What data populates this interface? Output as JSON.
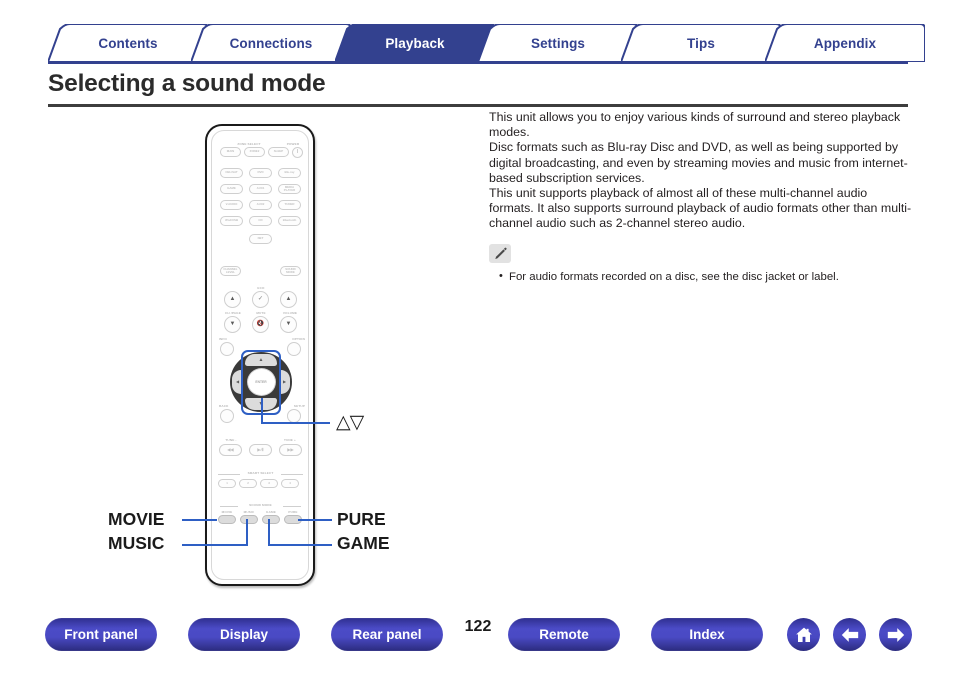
{
  "tabs": [
    {
      "label": "Contents",
      "active": false
    },
    {
      "label": "Connections",
      "active": false
    },
    {
      "label": "Playback",
      "active": true
    },
    {
      "label": "Settings",
      "active": false
    },
    {
      "label": "Tips",
      "active": false
    },
    {
      "label": "Appendix",
      "active": false
    }
  ],
  "page": {
    "title": "Selecting a sound mode",
    "number": "122"
  },
  "body": {
    "paragraphs": [
      "This unit allows you to enjoy various kinds of surround and stereo playback modes.",
      "Disc formats such as Blu-ray Disc and DVD, as well as being supported by digital broadcasting, and even by streaming movies and music from internet-based subscription services.",
      "This unit supports playback of almost all of these multi-channel audio formats. It also supports surround playback of audio formats other than multi-channel audio such as 2-channel stereo audio."
    ]
  },
  "note": {
    "icon": "pencil-note-icon",
    "items": [
      "For audio formats recorded on a disc, see the disc jacket or label."
    ]
  },
  "callouts": {
    "cursor_updown": "△▽",
    "movie": "MOVIE",
    "music": "MUSIC",
    "pure": "PURE",
    "game": "GAME"
  },
  "remote": {
    "sections": {
      "zone_select": "ZONE SELECT",
      "power": "POWER",
      "sound_mode": "SOUND MODE",
      "smart_select": "SMART SELECT"
    },
    "labels": {
      "ch_page": "CH /PAGE",
      "volume": "VOLUME",
      "eco": "ECO",
      "mute": "MUTE",
      "info": "INFO",
      "option": "OPTION",
      "back": "BACK",
      "setup": "SETUP",
      "tune_minus": "TUNE -",
      "tune_plus": "TUNE +",
      "enter": "ENTER"
    },
    "source_buttons": [
      "MAIN",
      "ZONE2",
      "SLEEP",
      "CBL/SAT",
      "DVD",
      "Blu-ray",
      "GAME",
      "AUX1",
      "MEDIA PLAYER",
      "V.AUDIO",
      "AUX2",
      "TUNER",
      "iPod/USB",
      "CD",
      "Bluetooth",
      "NET"
    ],
    "sound_mode_buttons": [
      "MOVIE",
      "MUSIC",
      "GAME",
      "PURE"
    ],
    "smart_select_buttons": [
      "1",
      "2",
      "3",
      "4"
    ],
    "transport": [
      "◀◀",
      "▶/Ⅱ",
      "▶▶"
    ]
  },
  "bottom_nav": {
    "buttons": [
      {
        "label": "Front panel"
      },
      {
        "label": "Display"
      },
      {
        "label": "Rear panel"
      },
      {
        "label": "Remote"
      },
      {
        "label": "Index"
      }
    ],
    "icons": [
      {
        "name": "home-icon"
      },
      {
        "name": "back-arrow-icon"
      },
      {
        "name": "forward-arrow-icon"
      }
    ]
  },
  "colors": {
    "brand_blue": "#33418f",
    "callout_blue": "#2e5fc4",
    "nav_button": "#4a4ac4"
  }
}
